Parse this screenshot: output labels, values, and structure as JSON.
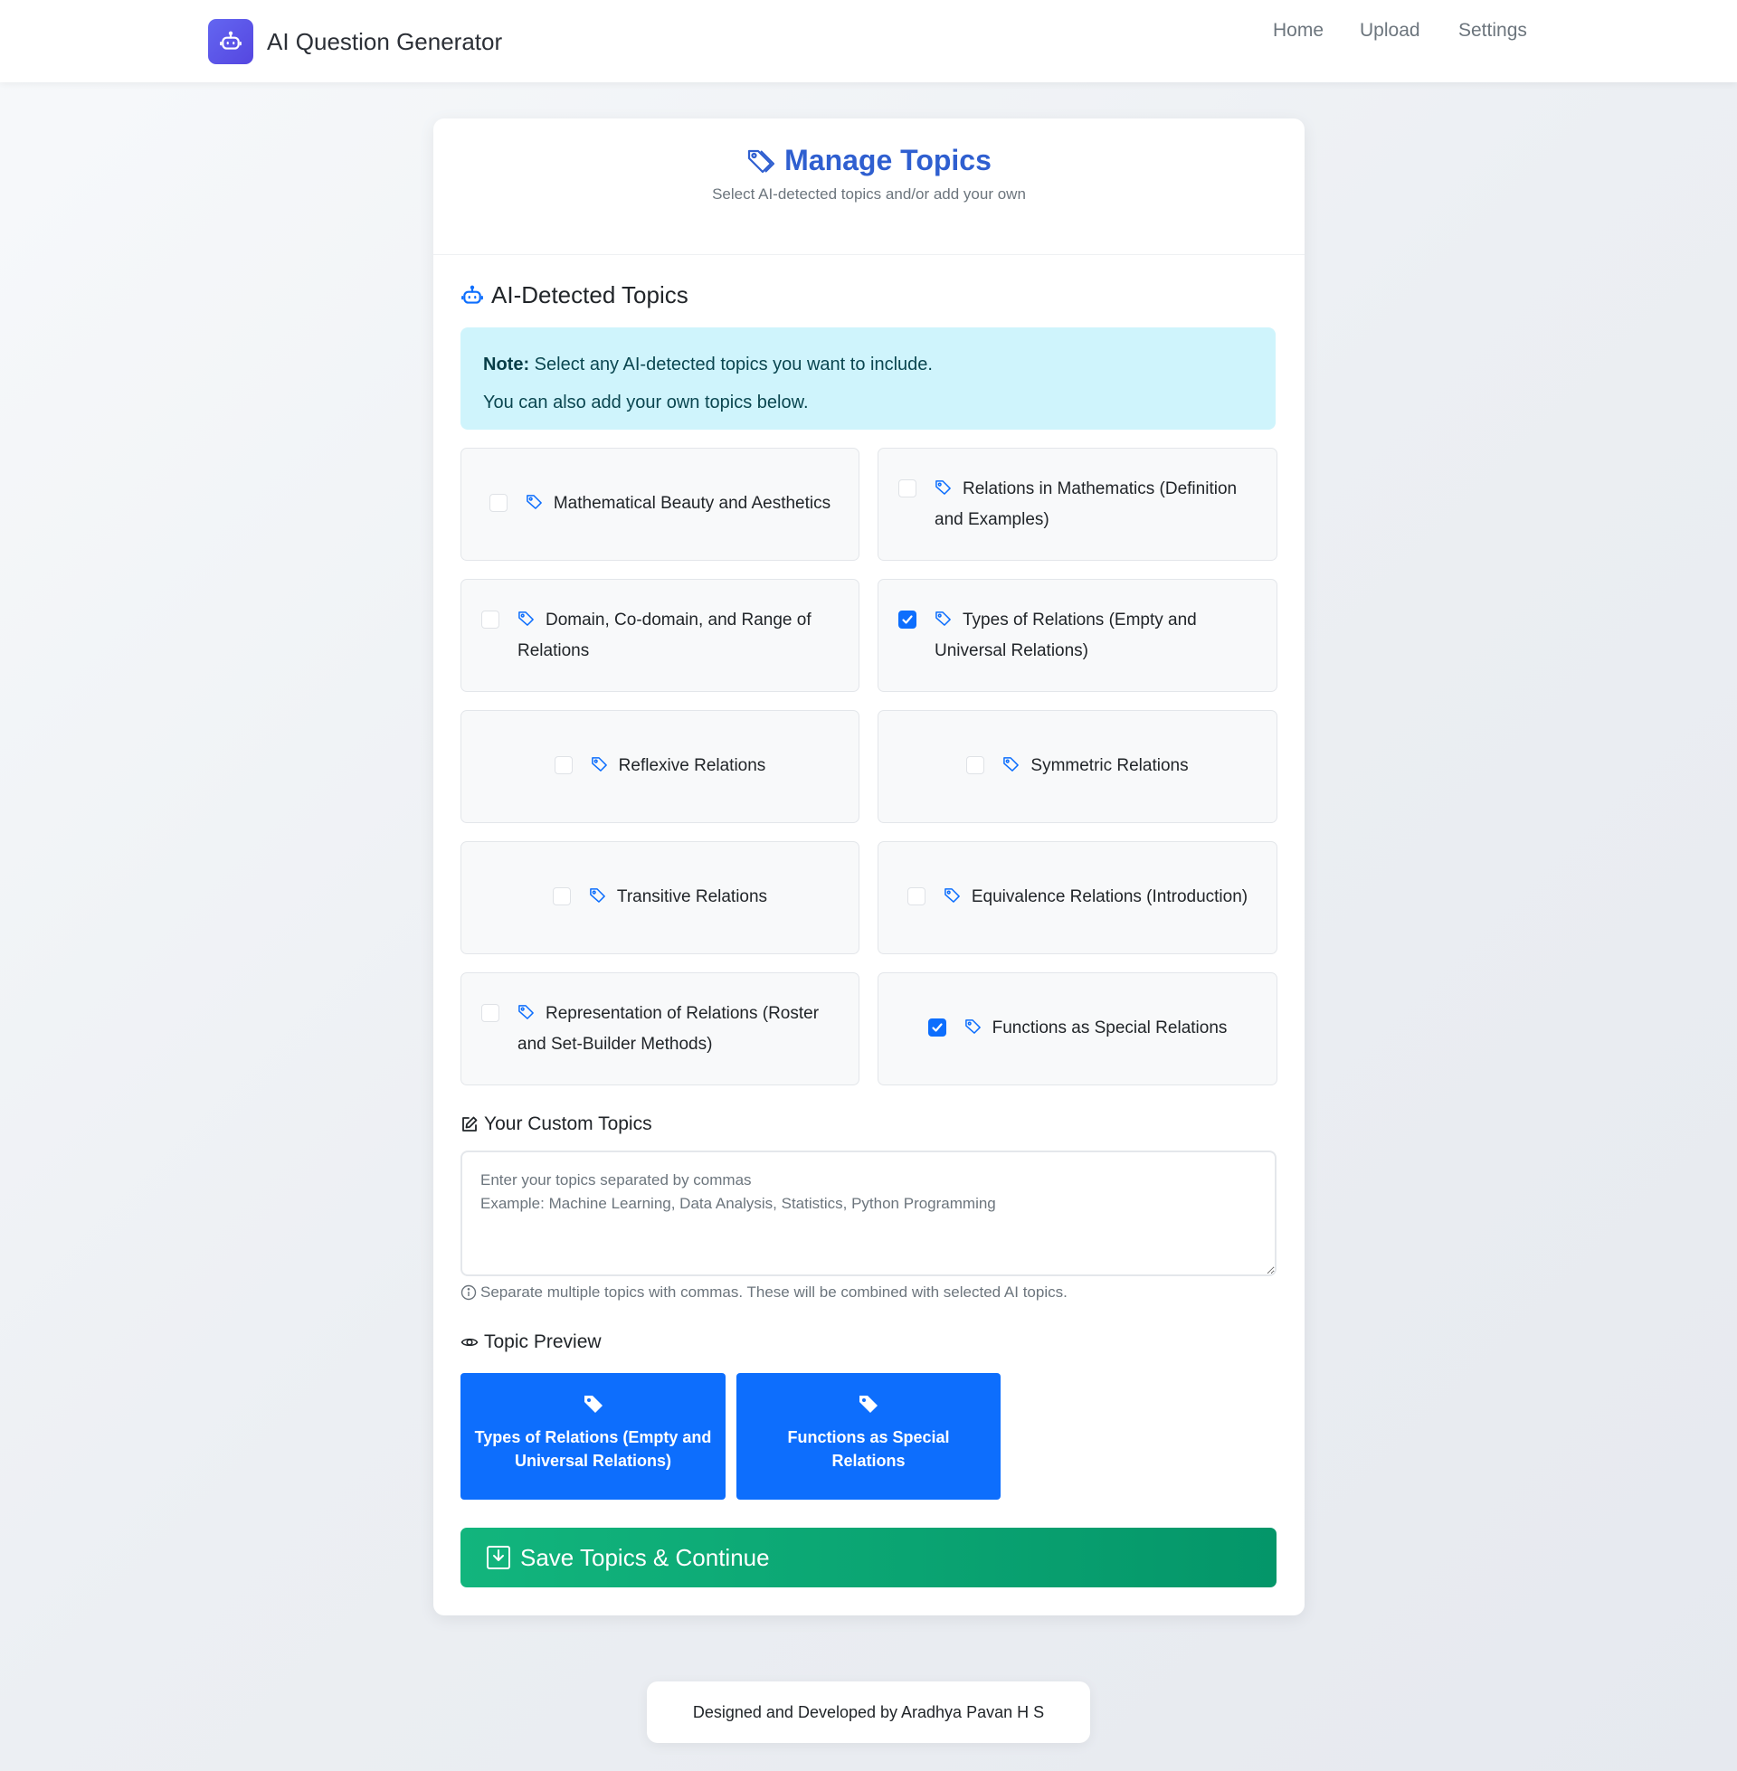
{
  "navbar": {
    "brand_title": "AI Question Generator",
    "links": [
      "Home",
      "Upload",
      "Settings"
    ]
  },
  "header": {
    "title": "Manage Topics",
    "subtitle": "Select AI-detected topics and/or add your own"
  },
  "ai_section": {
    "title": "AI-Detected Topics",
    "note_label": "Note:",
    "note_line1": "Select any AI-detected topics you want to include.",
    "note_line2": "You can also add your own topics below."
  },
  "topics": [
    {
      "label": "Mathematical Beauty and Aesthetics",
      "checked": false
    },
    {
      "label": "Relations in Mathematics (Definition and Examples)",
      "checked": false
    },
    {
      "label": "Domain, Co-domain, and Range of Relations",
      "checked": false
    },
    {
      "label": "Types of Relations (Empty and Universal Relations)",
      "checked": true
    },
    {
      "label": "Reflexive Relations",
      "checked": false
    },
    {
      "label": "Symmetric Relations",
      "checked": false
    },
    {
      "label": "Transitive Relations",
      "checked": false
    },
    {
      "label": "Equivalence Relations (Introduction)",
      "checked": false
    },
    {
      "label": "Representation of Relations (Roster and Set-Builder Methods)",
      "checked": false
    },
    {
      "label": "Functions as Special Relations",
      "checked": true
    }
  ],
  "custom": {
    "label": "Your Custom Topics",
    "value": "",
    "placeholder": "Enter your topics separated by commas\nExample: Machine Learning, Data Analysis, Statistics, Python Programming",
    "hint": "Separate multiple topics with commas. These will be combined with selected AI topics."
  },
  "preview": {
    "label": "Topic Preview",
    "chips": [
      "Types of Relations (Empty and Universal Relations)",
      "Functions as Special Relations"
    ]
  },
  "save_button": "Save Topics & Continue",
  "footer": "Designed and Developed by Aradhya Pavan H S",
  "colors": {
    "accent": "#2f5fd0",
    "primary": "#0d6efd",
    "success": "#12b57d",
    "note_bg": "#cff4fc"
  }
}
